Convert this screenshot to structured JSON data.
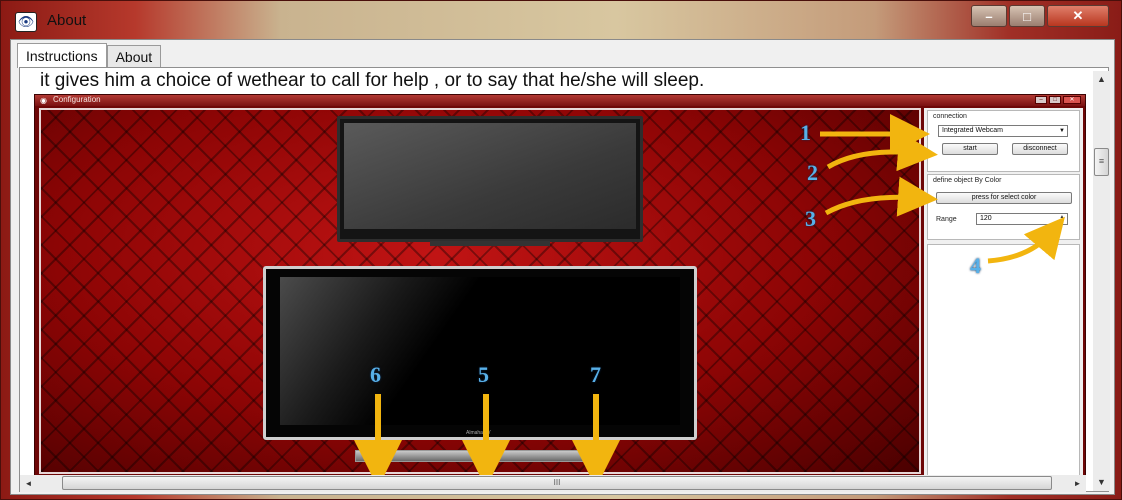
{
  "window": {
    "title": "About",
    "icon": "eye-app-icon",
    "controls": {
      "minimize": "–",
      "maximize": "□",
      "close": "✕"
    }
  },
  "tabs": [
    {
      "label": "Instructions",
      "active": true
    },
    {
      "label": "About",
      "active": false
    }
  ],
  "instructions": {
    "text": "it gives him a choice of wethear to call for help , or to say that he/she will sleep."
  },
  "configuration": {
    "title": "Configuration",
    "connection": {
      "label": "connection",
      "camera_value": "Integrated Webcam",
      "start_label": "start",
      "disconnect_label": "disconnect"
    },
    "define_object": {
      "label": "define object By Color",
      "select_color_label": "press for select color",
      "range_label": "Range",
      "range_value": "120"
    },
    "tv_brand": "Almaha TV"
  },
  "annotations": {
    "numbers": [
      "1",
      "2",
      "3",
      "4",
      "5",
      "6",
      "7"
    ],
    "arrow_color": "#f2b50f",
    "number_color": "#58b0e8"
  },
  "scrollbars": {
    "vertical_thumb": "≡",
    "horizontal_thumb": "III",
    "up": "▲",
    "down": "▼",
    "left": "◄",
    "right": "►"
  }
}
